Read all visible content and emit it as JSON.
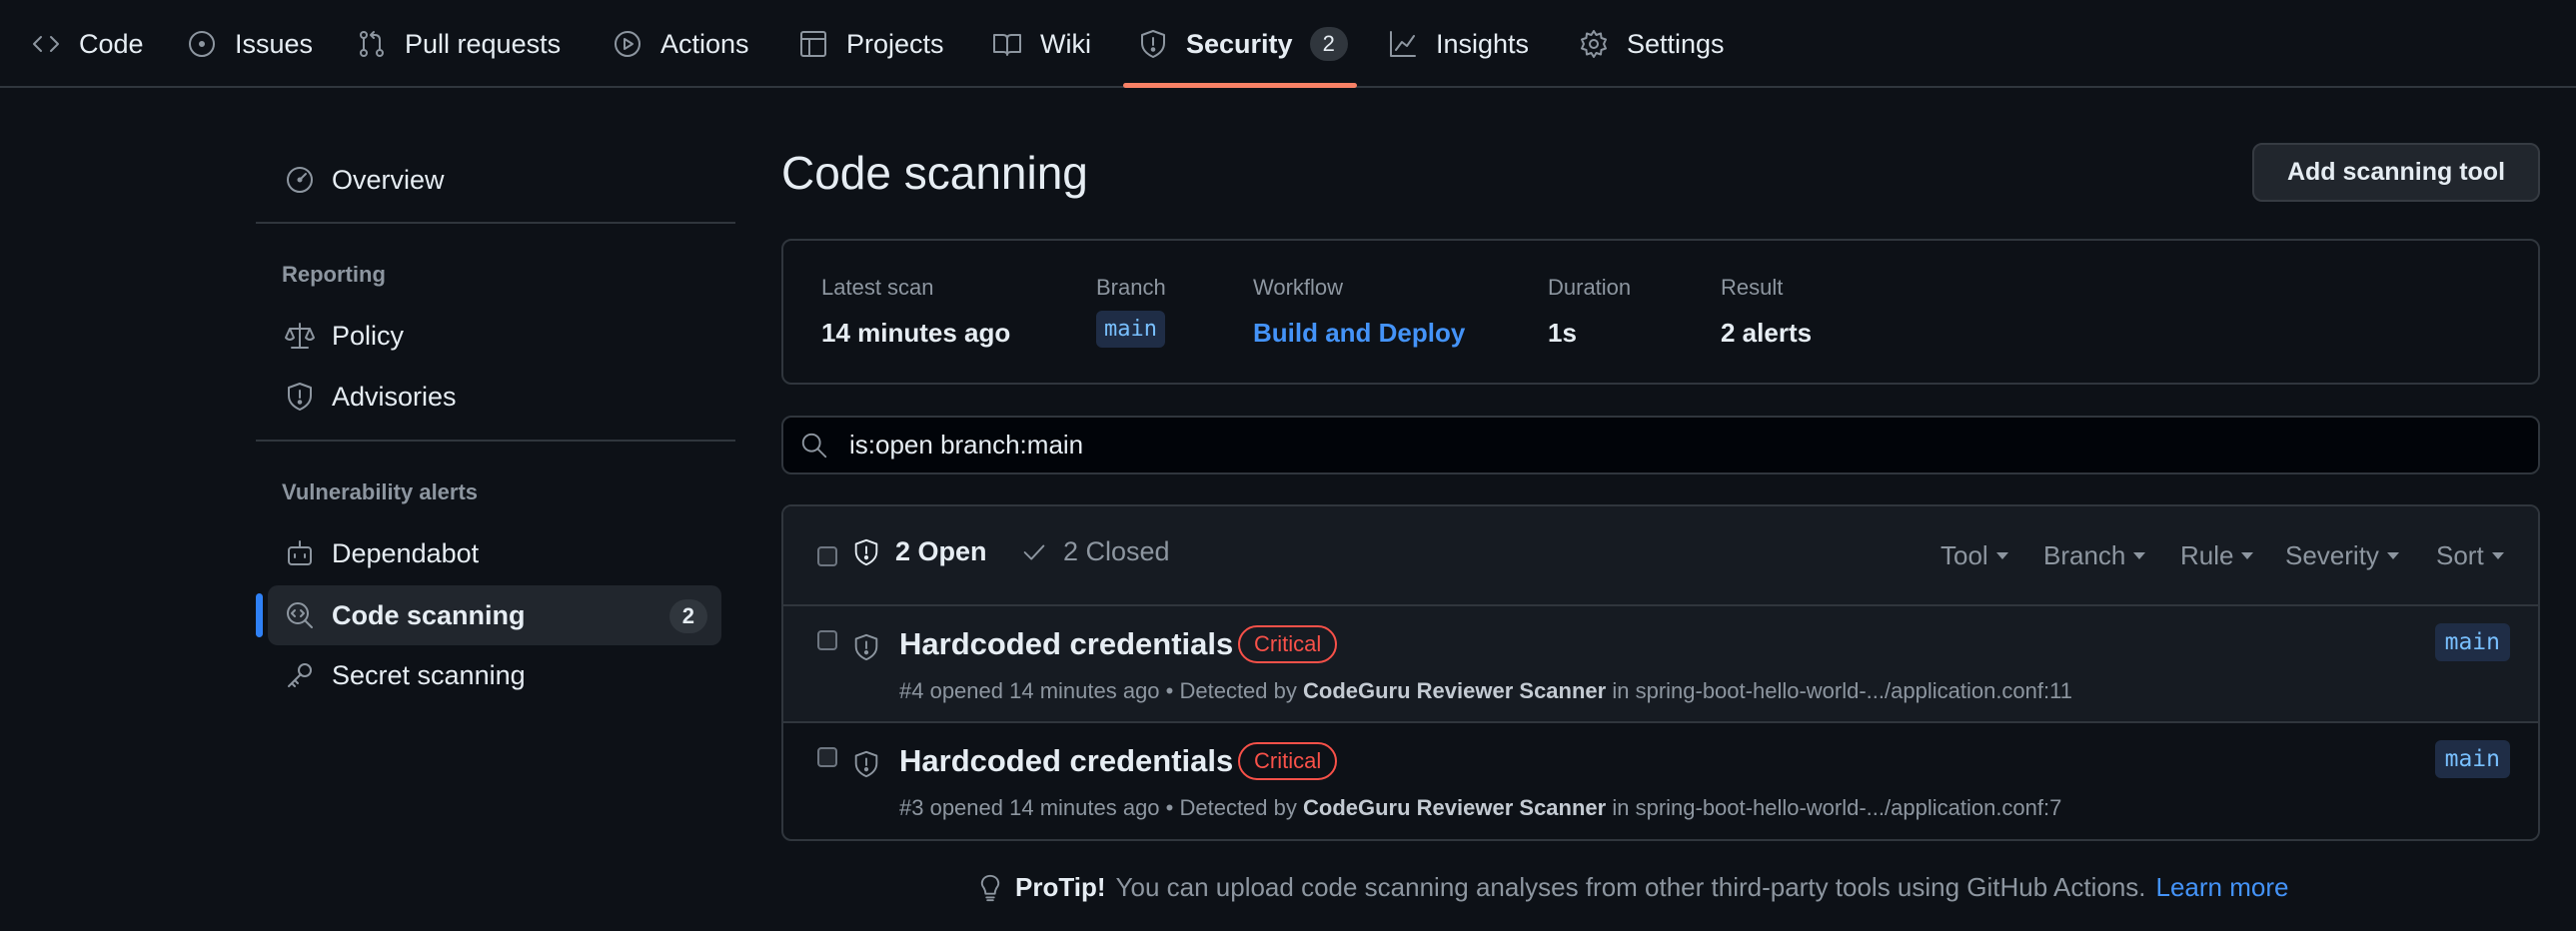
{
  "repo_nav": {
    "tabs": [
      {
        "label": "Code",
        "icon": "code-icon"
      },
      {
        "label": "Issues",
        "icon": "issue-opened-icon"
      },
      {
        "label": "Pull requests",
        "icon": "git-pull-request-icon"
      },
      {
        "label": "Actions",
        "icon": "play-icon"
      },
      {
        "label": "Projects",
        "icon": "table-icon"
      },
      {
        "label": "Wiki",
        "icon": "book-icon"
      },
      {
        "label": "Security",
        "icon": "shield-icon",
        "count": "2",
        "selected": true
      },
      {
        "label": "Insights",
        "icon": "graph-icon"
      },
      {
        "label": "Settings",
        "icon": "gear-icon"
      }
    ],
    "selected_underline_color": "#f78166"
  },
  "sidebar": {
    "overview": {
      "label": "Overview",
      "icon": "meter-icon"
    },
    "reporting_heading": "Reporting",
    "reporting": [
      {
        "label": "Policy",
        "icon": "law-icon"
      },
      {
        "label": "Advisories",
        "icon": "shield-icon"
      }
    ],
    "vulnerability_heading": "Vulnerability alerts",
    "vulnerability": [
      {
        "label": "Dependabot",
        "icon": "dependabot-icon"
      },
      {
        "label": "Code scanning",
        "icon": "codescan-icon",
        "count": "2",
        "selected": true
      },
      {
        "label": "Secret scanning",
        "icon": "key-icon"
      }
    ]
  },
  "main": {
    "title": "Code scanning",
    "add_tool_label": "Add scanning tool",
    "scan": {
      "latest_label": "Latest scan",
      "latest_value": "14 minutes ago",
      "branch_label": "Branch",
      "branch_value": "main",
      "workflow_label": "Workflow",
      "workflow_value": "Build and Deploy",
      "duration_label": "Duration",
      "duration_value": "1s",
      "result_label": "Result",
      "result_value": "2 alerts"
    },
    "search": {
      "query": "is:open branch:main"
    },
    "alerts_header": {
      "open_label": "2 Open",
      "closed_label": "2 Closed",
      "filters": [
        "Tool",
        "Branch",
        "Rule",
        "Severity",
        "Sort"
      ]
    },
    "alerts": [
      {
        "title": "Hardcoded credentials",
        "severity": "Critical",
        "meta": "#4 opened 14 minutes ago • Detected by",
        "tool": "CodeGuru Reviewer Scanner",
        "location": "in spring-boot-hello-world-.../application.conf:11",
        "branch": "main"
      },
      {
        "title": "Hardcoded credentials",
        "severity": "Critical",
        "meta": "#3 opened 14 minutes ago • Detected by",
        "tool": "CodeGuru Reviewer Scanner",
        "location": "in spring-boot-hello-world-.../application.conf:7",
        "branch": "main"
      }
    ],
    "protip": {
      "strong": "ProTip!",
      "text": "You can upload code scanning analyses from other third-party tools using GitHub Actions.",
      "link": "Learn more"
    }
  },
  "colors": {
    "background": "#0d1117",
    "link": "#4493f8",
    "critical": "#f85149",
    "accent": "#2f81f7"
  }
}
